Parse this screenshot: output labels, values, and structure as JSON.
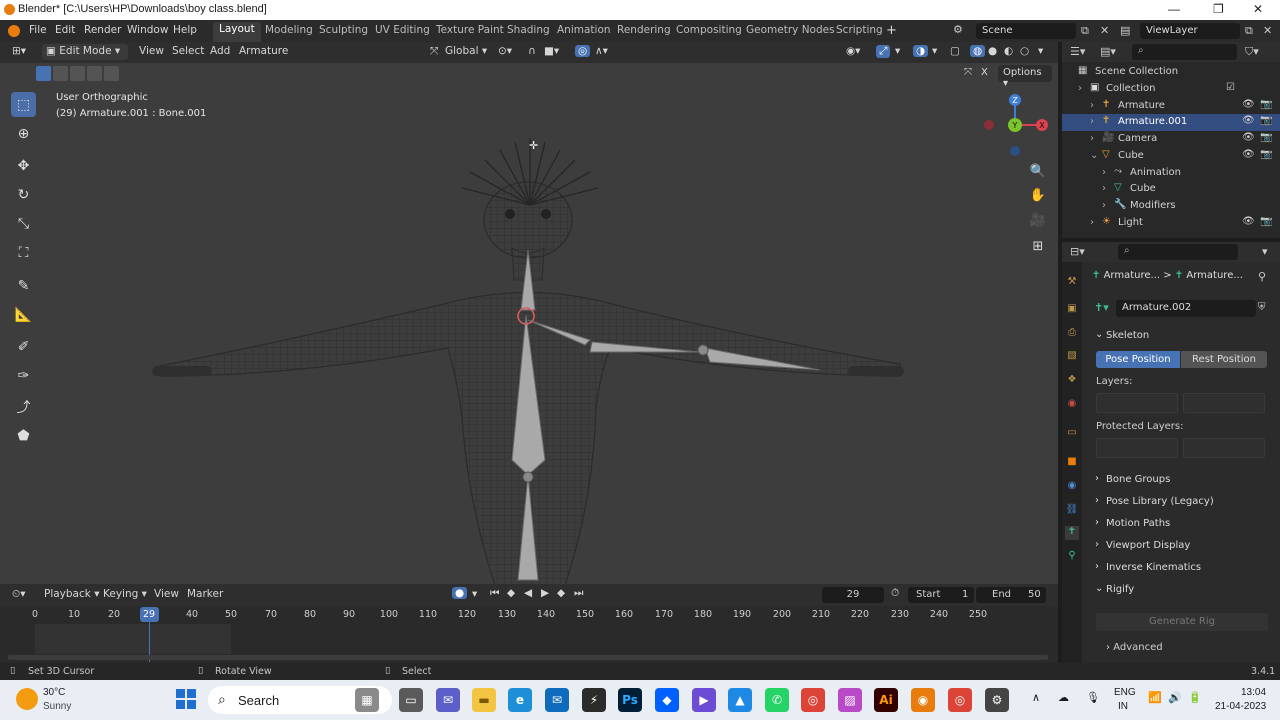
{
  "window": {
    "title": "Blender* [C:\\Users\\HP\\Downloads\\boy class.blend]",
    "minimize": "—",
    "maximize": "❐",
    "close": "✕"
  },
  "menu": [
    "File",
    "Edit",
    "Render",
    "Window",
    "Help"
  ],
  "workspaces": [
    "Layout",
    "Modeling",
    "Sculpting",
    "UV Editing",
    "Texture Paint",
    "Shading",
    "Animation",
    "Rendering",
    "Compositing",
    "Geometry Nodes",
    "Scripting"
  ],
  "active_workspace": "Layout",
  "add_workspace": "+",
  "scene": {
    "label": "Scene",
    "view_layer": "ViewLayer"
  },
  "viewport_header": {
    "mode": "Edit Mode",
    "menus": [
      "View",
      "Select",
      "Add",
      "Armature"
    ],
    "orientation": "Global",
    "options": "Options",
    "close_x": "X"
  },
  "viewport": {
    "view_name": "User Orthographic",
    "object_info": "(29) Armature.001 : Bone.001",
    "gizmo_labels": [
      "Z",
      "Y",
      "X"
    ]
  },
  "timeline": {
    "menus": [
      "Playback",
      "Keying",
      "View",
      "Marker"
    ],
    "current_frame": "29",
    "start_label": "Start",
    "start": "1",
    "end_label": "End",
    "end": "50",
    "ticks": [
      "0",
      "10",
      "20",
      "29",
      "40",
      "50",
      "70",
      "80",
      "90",
      "100",
      "110",
      "120",
      "130",
      "140",
      "150",
      "160",
      "170",
      "180",
      "190",
      "200",
      "210",
      "220",
      "230",
      "240",
      "250"
    ]
  },
  "statusbar": {
    "items": [
      "Set 3D Cursor",
      "Rotate View",
      "Select"
    ],
    "version": "3.4.1"
  },
  "outliner": {
    "root": "Scene Collection",
    "rows": [
      {
        "label": "Collection",
        "indent": 1,
        "selected": false,
        "icon": "collection-icon"
      },
      {
        "label": "Armature",
        "indent": 2,
        "selected": false,
        "icon": "armature-icon"
      },
      {
        "label": "Armature.001",
        "indent": 2,
        "selected": true,
        "icon": "armature-icon"
      },
      {
        "label": "Camera",
        "indent": 2,
        "selected": false,
        "icon": "camera-icon"
      },
      {
        "label": "Cube",
        "indent": 2,
        "selected": false,
        "icon": "mesh-icon"
      },
      {
        "label": "Animation",
        "indent": 3,
        "selected": false,
        "icon": "animation-icon"
      },
      {
        "label": "Cube",
        "indent": 3,
        "selected": false,
        "icon": "mesh-data-icon"
      },
      {
        "label": "Modifiers",
        "indent": 3,
        "selected": false,
        "icon": "wrench-icon"
      },
      {
        "label": "Light",
        "indent": 2,
        "selected": false,
        "icon": "light-icon"
      }
    ]
  },
  "properties": {
    "breadcrumb_1": "Armature...",
    "breadcrumb_sep": ">",
    "breadcrumb_2": "Armature...",
    "data_name": "Armature.002",
    "skeleton": "Skeleton",
    "pose_position": "Pose Position",
    "rest_position": "Rest Position",
    "layers": "Layers:",
    "protected_layers": "Protected Layers:",
    "panels": [
      "Bone Groups",
      "Pose Library (Legacy)",
      "Motion Paths",
      "Viewport Display",
      "Inverse Kinematics"
    ],
    "rigify": "Rigify",
    "generate_rig": "Generate Rig",
    "advanced": "Advanced"
  },
  "taskbar": {
    "weather_temp": "30°C",
    "weather_desc": "Sunny",
    "search": "Search",
    "lang_1": "ENG",
    "lang_2": "IN",
    "time": "13:04",
    "date": "21-04-2023"
  },
  "colors": {
    "accent": "#4772b3",
    "selected_row": "#334d80",
    "orange_object": "#e87d0d",
    "viewport_bg": "#3d3d3d"
  }
}
